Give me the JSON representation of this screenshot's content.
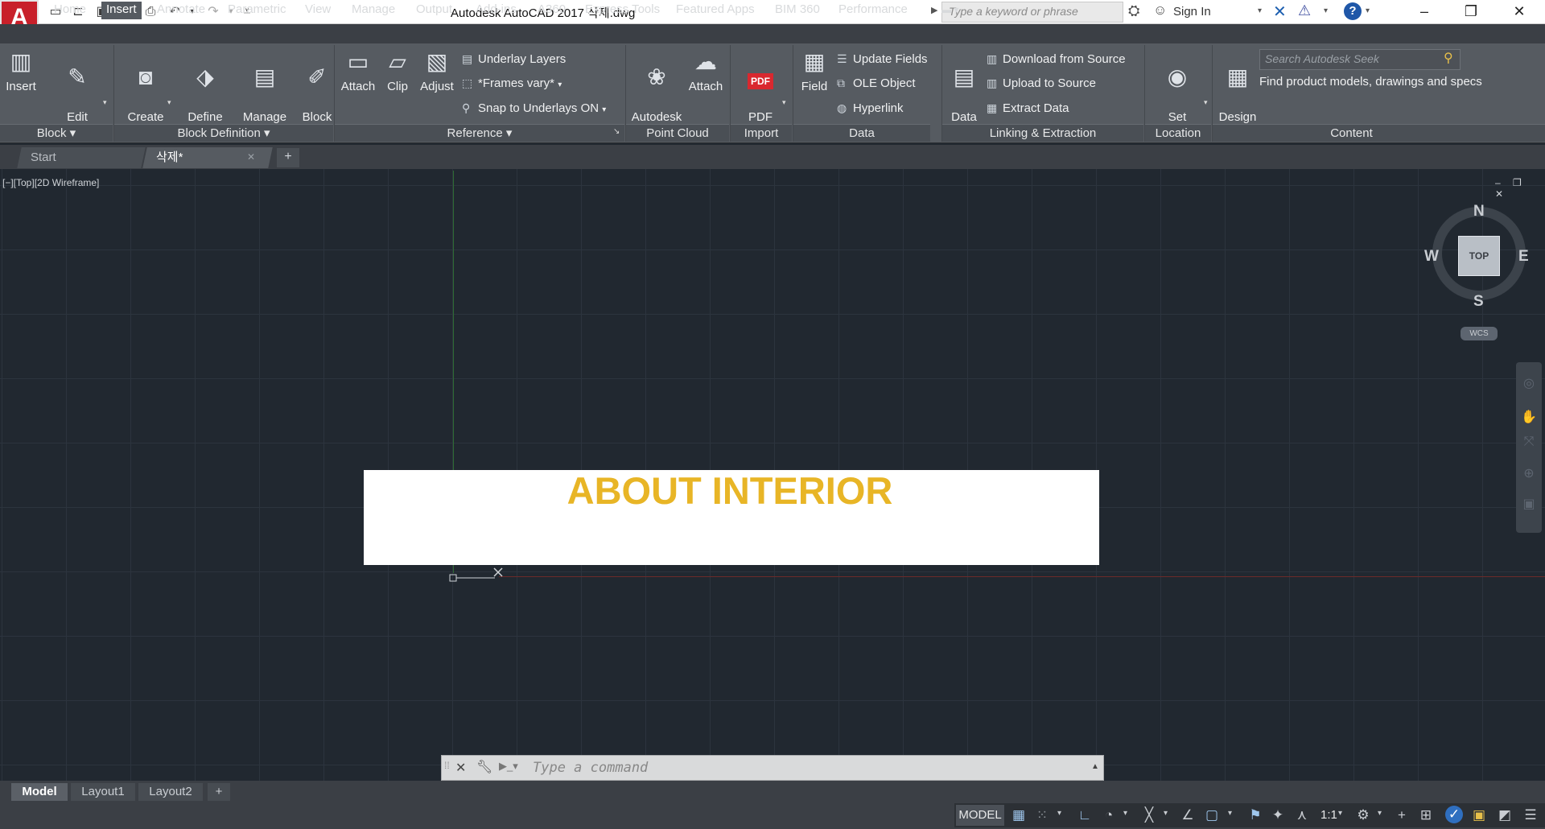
{
  "app": {
    "logo_letter": "A",
    "window_title": "Autodesk AutoCAD 2017    삭제.dwg",
    "search_placeholder": "Type a keyword or phrase",
    "sign_in": "Sign In",
    "help": "?"
  },
  "ribbon_tabs": [
    "Home",
    "Insert",
    "Annotate",
    "Parametric",
    "View",
    "Manage",
    "Output",
    "Add-ins",
    "A360",
    "Express Tools",
    "Featured Apps",
    "BIM 360",
    "Performance"
  ],
  "ribbon_active_tab": "Insert",
  "panels": {
    "block": {
      "title": "Block",
      "insert": "Insert",
      "edit_attribute": "Edit\nAttribute"
    },
    "block_definition": {
      "title": "Block Definition",
      "create_block": "Create\nBlock",
      "define_attributes": "Define\nAttributes",
      "manage_attributes": "Manage\nAttributes",
      "block_editor": "Block\nEditor"
    },
    "reference": {
      "title": "Reference",
      "attach": "Attach",
      "clip": "Clip",
      "adjust": "Adjust",
      "underlay_layers": "Underlay Layers",
      "frames_vary": "*Frames vary*",
      "snap_to_underlays": "Snap to Underlays ON"
    },
    "point_cloud": {
      "title": "Point Cloud",
      "autodesk_recap": "Autodesk\nReCap",
      "attach": "Attach"
    },
    "import": {
      "title": "Import",
      "pdf_import": "PDF\nImport",
      "pdf_badge": "PDF"
    },
    "data": {
      "title": "Data",
      "field": "Field",
      "update_fields": "Update Fields",
      "ole_object": "OLE Object",
      "hyperlink": "Hyperlink"
    },
    "linking_extraction": {
      "title": "Linking & Extraction",
      "data_link": "Data\nLink",
      "download_from_source": "Download from Source",
      "upload_to_source": "Upload to Source",
      "extract_data": "Extract  Data"
    },
    "location": {
      "title": "Location",
      "set_location": "Set\nLocation"
    },
    "content": {
      "title": "Content",
      "design_center": "Design\nCenter",
      "seek_placeholder": "Search Autodesk Seek",
      "seek_text": "Find product models, drawings and specs"
    }
  },
  "doc_tabs": {
    "start": "Start",
    "active": "삭제*",
    "close": "✕",
    "add": "+"
  },
  "viewport": {
    "label": "[−][Top][2D Wireframe]",
    "window_controls": "– ❐ ✕",
    "drawing_text": "ABOUT INTERIOR",
    "drawing_text_color": "#e8b526"
  },
  "viewcube": {
    "north": "N",
    "south": "S",
    "east": "E",
    "west": "W",
    "face": "TOP",
    "ucs": "WCS"
  },
  "command_line": {
    "placeholder": "Type  a  command"
  },
  "layout_tabs": [
    "Model",
    "Layout1",
    "Layout2"
  ],
  "layout_add": "+",
  "status_bar": {
    "model": "MODEL",
    "scale": "1:1"
  }
}
